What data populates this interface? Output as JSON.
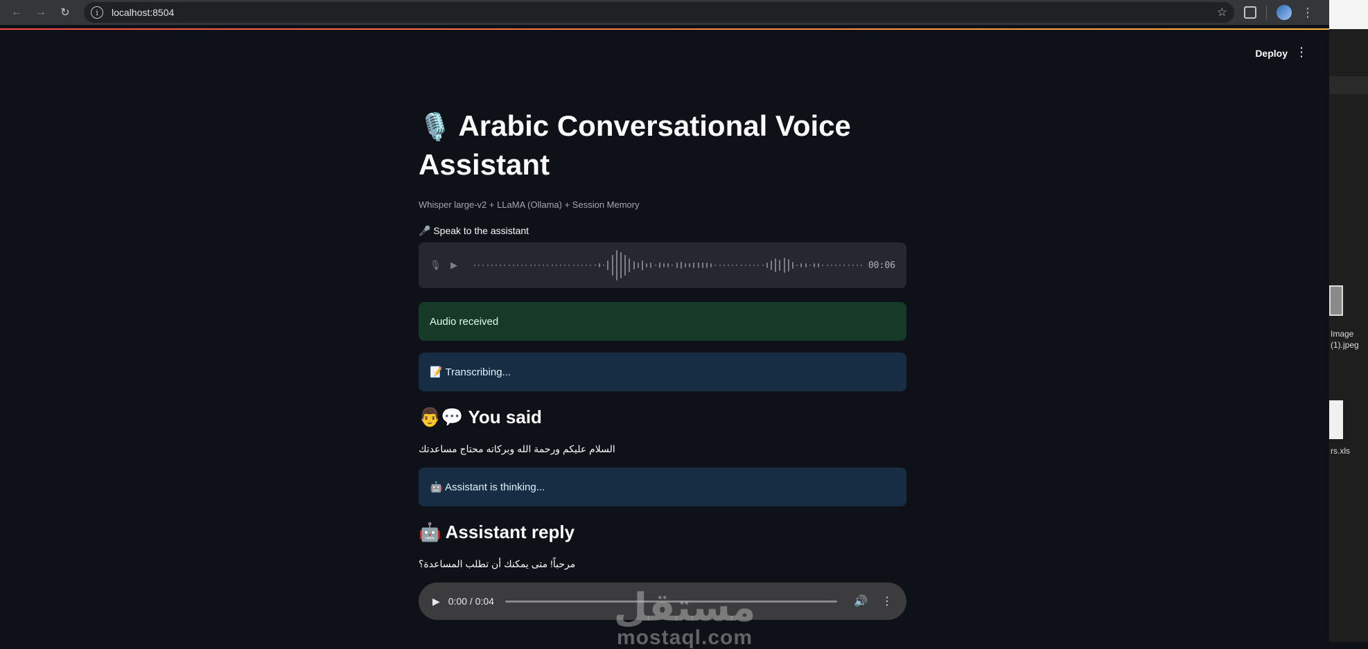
{
  "browser": {
    "url": "localhost:8504",
    "back_icon": "back-arrow-icon",
    "forward_icon": "forward-arrow-icon",
    "reload_icon": "reload-icon"
  },
  "app": {
    "deploy_label": "Deploy",
    "title_emoji": "🎙️",
    "title": "Arabic Conversational Voice Assistant",
    "caption": "Whisper large-v2 + LLaMA (Ollama) + Session Memory",
    "recorder_label": "🎤 Speak to the assistant",
    "recorder_time": "00:06",
    "audio_received": "Audio received",
    "transcribing": "📝 Transcribing...",
    "you_said_heading": "👨💬 You said",
    "user_text": "السلام عليكم ورحمة الله وبركاته محتاج مساعدتك",
    "thinking": "🤖 Assistant is thinking...",
    "reply_heading": "🤖 Assistant reply",
    "assistant_text": "مرحباً! متى يمكنك أن تطلب المساعدة؟",
    "player_time": "0:00 / 0:04"
  },
  "finder": {
    "file1_line1": "Image",
    "file1_line2": "(1).jpeg",
    "file2": "rs.xls"
  },
  "watermark": {
    "arabic": "مستقل",
    "latin": "mostaql.com"
  }
}
